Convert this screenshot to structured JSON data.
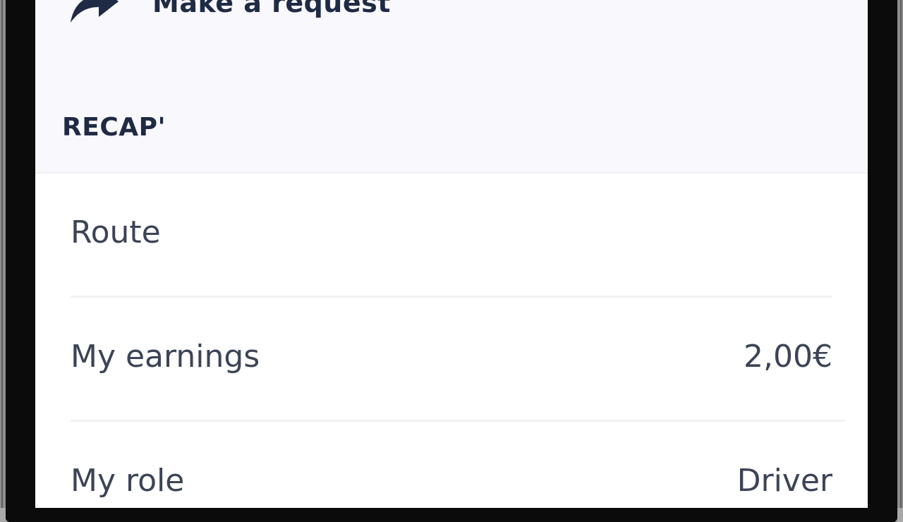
{
  "request": {
    "label": "Make a request",
    "icon": "share-forward-icon"
  },
  "recap": {
    "title": "RECAP'",
    "rows": [
      {
        "label": "Route",
        "value": ""
      },
      {
        "label": "My earnings",
        "value": "2,00€"
      },
      {
        "label": "My role",
        "value": "Driver"
      }
    ]
  },
  "colors": {
    "text_dark": "#1f2a44",
    "text_body": "#3c4456",
    "panel_bg": "#f8f8fd",
    "divider": "#f1f1f4"
  }
}
